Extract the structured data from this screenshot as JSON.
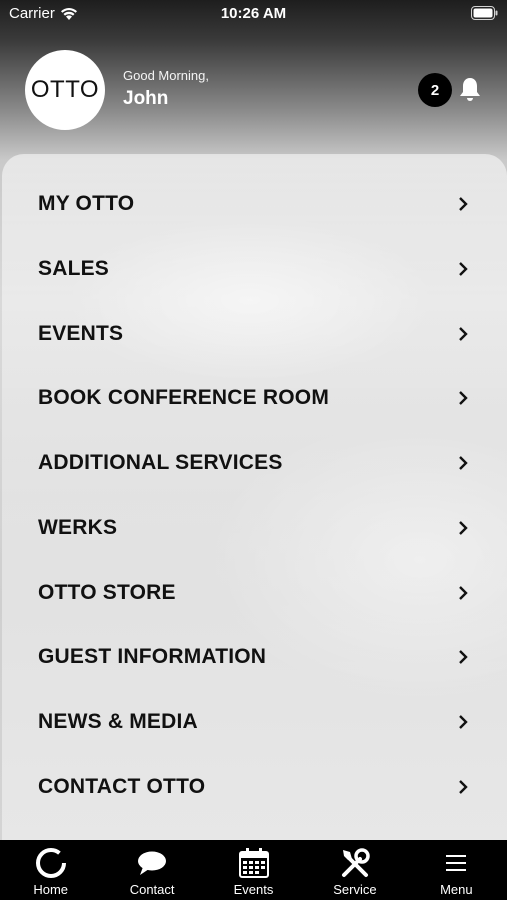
{
  "status_bar": {
    "carrier": "Carrier",
    "time": "10:26 AM"
  },
  "header": {
    "logo_text": "OTTO",
    "greeting": "Good Morning,",
    "username": "John",
    "notification_count": "2"
  },
  "menu": {
    "items": [
      {
        "label": "MY OTTO"
      },
      {
        "label": "SALES"
      },
      {
        "label": "EVENTS"
      },
      {
        "label": "BOOK CONFERENCE ROOM"
      },
      {
        "label": "ADDITIONAL SERVICES"
      },
      {
        "label": "WERKS"
      },
      {
        "label": "OTTO STORE"
      },
      {
        "label": "GUEST INFORMATION"
      },
      {
        "label": "NEWS & MEDIA"
      },
      {
        "label": "CONTACT OTTO"
      }
    ]
  },
  "tab_bar": {
    "tabs": [
      {
        "label": "Home",
        "icon": "home-ring-icon"
      },
      {
        "label": "Contact",
        "icon": "chat-bubble-icon"
      },
      {
        "label": "Events",
        "icon": "calendar-icon"
      },
      {
        "label": "Service",
        "icon": "tools-icon"
      },
      {
        "label": "Menu",
        "icon": "hamburger-icon"
      }
    ]
  },
  "colors": {
    "tab_bar_bg": "#000000",
    "badge_bg": "#000000",
    "text": "#111111"
  }
}
